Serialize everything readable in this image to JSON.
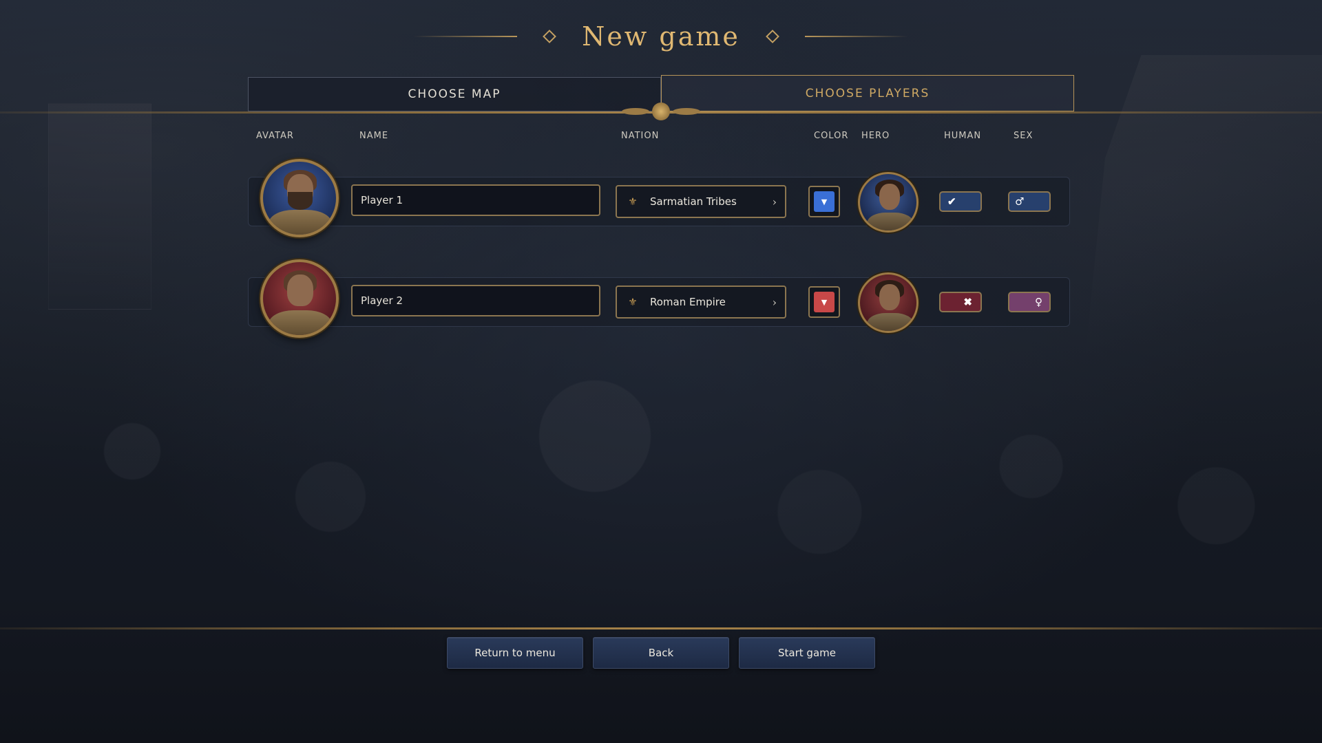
{
  "title": "New game",
  "tabs": [
    {
      "label": "CHOOSE MAP",
      "active": false
    },
    {
      "label": "CHOOSE PLAYERS",
      "active": true
    }
  ],
  "columns": {
    "avatar": "AVATAR",
    "name": "NAME",
    "nation": "NATION",
    "color": "COLOR",
    "hero": "HERO",
    "human": "HUMAN",
    "sex": "SEX"
  },
  "players": [
    {
      "name": "Player 1",
      "nation": "Sarmatian Tribes",
      "nation_icon": "griffin-icon",
      "color": "#3a6fd6",
      "avatar_theme": "blue",
      "human": true,
      "sex": "male",
      "human_glyph": "✔",
      "sex_glyph": "♂"
    },
    {
      "name": "Player 2",
      "nation": "Roman Empire",
      "nation_icon": "eagle-icon",
      "color": "#c84848",
      "avatar_theme": "red",
      "human": false,
      "sex": "female",
      "human_glyph": "✖",
      "sex_glyph": "♀"
    }
  ],
  "footer": {
    "return_label": "Return to menu",
    "back_label": "Back",
    "start_label": "Start game"
  },
  "colors": {
    "gold": "#e0b872",
    "accent_blue": "#27406d",
    "accent_red": "#6c2231"
  }
}
